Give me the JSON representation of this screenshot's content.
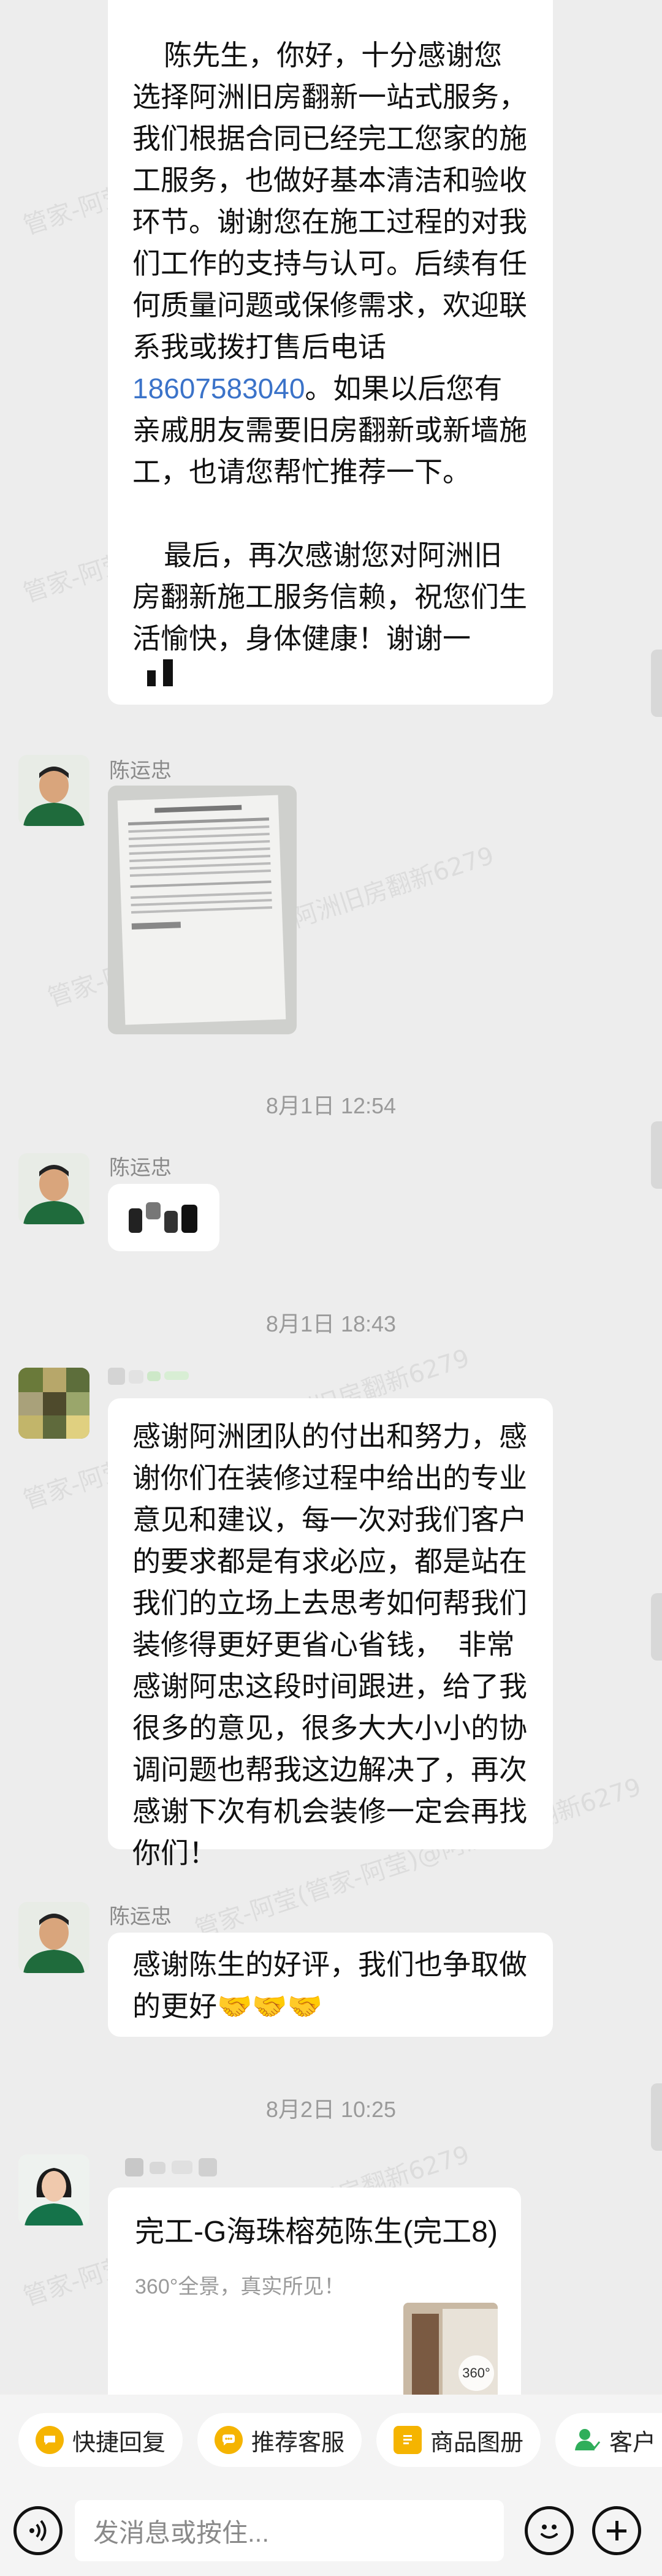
{
  "watermark": "管家-阿莹(管家-阿莹)@阿洲旧房翻新6279",
  "messages": {
    "first": {
      "para1_a": "    陈先生，你好，十分感谢您选择阿洲旧房翻新一站式服务，我们根据合同已经完工您家的施工服务，也做好基本清洁和验收环节。谢谢您在施工过程的对我们工作的支持与认可。后续有任何质量问题或保修需求，欢迎联系我或拨打售后电话",
      "phone": "18607583040",
      "para1_b": "。如果以后您有亲戚朋友需要旧房翻新或新墙施工，也请您帮忙推荐一下。",
      "para2": "    最后，再次感谢您对阿洲旧房翻新施工服务信赖，祝您们生活愉快，身体健康！谢谢一"
    },
    "photo_sender": "陈运忠",
    "time1": "8月1日  12:54",
    "blurred_sender": "陈运忠",
    "time2": "8月1日  18:43",
    "customer_review": "感谢阿洲团队的付出和努力，感谢你们在装修过程中给出的专业意见和建议，每一次对我们客户的要求都是有求必应，都是站在我们的立场上去思考如何帮我们装修得更好更省心省钱，  非常感谢阿忠这段时间跟进，给了我很多的意见，很多大大小小的协调问题也帮我这边解决了，再次感谢下次有机会装修一定会再找你们！",
    "reply_sender": "陈运忠",
    "reply_text": "感谢陈生的好评，我们也争取做的更好🤝🤝🤝",
    "time3": "8月2日  10:25",
    "card": {
      "title": "完工-G海珠榕苑陈生(完工8)",
      "subtitle": "360°全景，真实所见！",
      "badge": "360°"
    }
  },
  "quick_actions": [
    {
      "label": "快捷回复",
      "icon": "reply-icon",
      "color": "#f5b400"
    },
    {
      "label": "推荐客服",
      "icon": "service-icon",
      "color": "#f5b400"
    },
    {
      "label": "商品图册",
      "icon": "album-icon",
      "color": "#f5b400"
    },
    {
      "label": "客户",
      "icon": "customer-icon",
      "color": "#2fae5a"
    }
  ],
  "input": {
    "placeholder": "发消息或按住..."
  }
}
